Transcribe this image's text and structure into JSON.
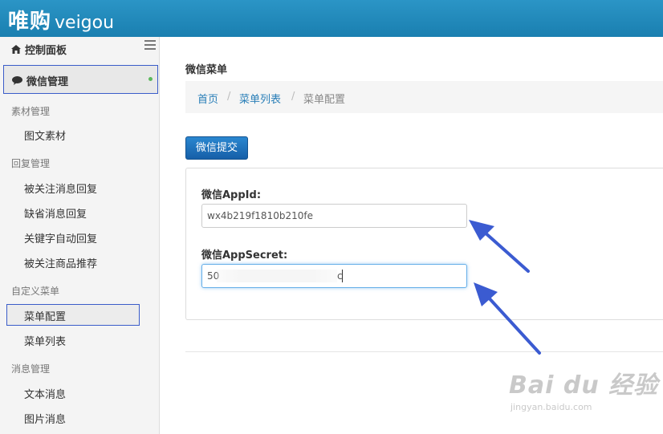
{
  "brand": {
    "cn": "唯购",
    "en": "veigou"
  },
  "sidebar": {
    "dashboard": "控制面板",
    "wechat_manage": "微信管理",
    "groups": [
      {
        "title": "素材管理",
        "items": [
          "图文素材"
        ]
      },
      {
        "title": "回复管理",
        "items": [
          "被关注消息回复",
          "缺省消息回复",
          "关键字自动回复",
          "被关注商品推荐"
        ]
      },
      {
        "title": "自定义菜单",
        "items": [
          "菜单配置",
          "菜单列表"
        ]
      },
      {
        "title": "消息管理",
        "items": [
          "文本消息",
          "图片消息"
        ]
      }
    ]
  },
  "main": {
    "title": "微信菜单",
    "breadcrumb": [
      "首页",
      "菜单列表",
      "菜单配置"
    ],
    "breadcrumb_sep": "/",
    "submit_label": "微信提交",
    "fields": {
      "appid_label": "微信AppId:",
      "appid_value": "wx4b219f1810b210fe",
      "secret_label": "微信AppSecret:",
      "secret_prefix": "50",
      "secret_suffix": "c"
    }
  },
  "watermark": {
    "main": "Bai du 经验",
    "sub": "jingyan.baidu.com"
  },
  "colors": {
    "topbar": "#1f88b8",
    "link": "#2a7fb8",
    "button": "#1a6fbd",
    "arrow": "#3b5bd1"
  }
}
